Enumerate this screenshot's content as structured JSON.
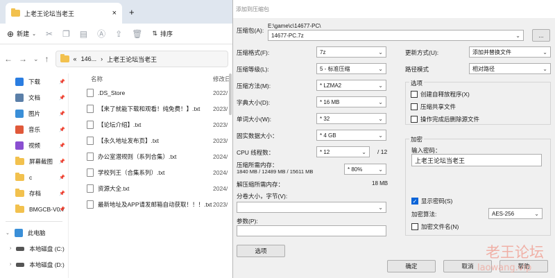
{
  "explorer": {
    "tab_title": "上老王论坛当老王",
    "tab_close": "×",
    "tab_add": "+",
    "new_label": "新建",
    "sort_label": "排序",
    "breadcrumb_root": "146...",
    "breadcrumb_current": "上老王论坛当老王",
    "sidebar": [
      {
        "label": "下载",
        "icon": "download-icon",
        "color": "#2a7de1"
      },
      {
        "label": "文档",
        "icon": "document-icon",
        "color": "#5b7fa8"
      },
      {
        "label": "图片",
        "icon": "picture-icon",
        "color": "#3a8fd8"
      },
      {
        "label": "音乐",
        "icon": "music-icon",
        "color": "#e0593a"
      },
      {
        "label": "视频",
        "icon": "video-icon",
        "color": "#8a4fd1"
      },
      {
        "label": "屏幕截图",
        "icon": "folder-icon",
        "color": "#f2c14e"
      },
      {
        "label": "c",
        "icon": "folder-icon",
        "color": "#f2c14e"
      },
      {
        "label": "存档",
        "icon": "folder-icon",
        "color": "#f2c14e"
      },
      {
        "label": "BMGCB-V0.7",
        "icon": "folder-icon",
        "color": "#f2c14e"
      }
    ],
    "this_pc": "此电脑",
    "drives": [
      "本地磁盘 (C:)",
      "本地磁盘 (D:)"
    ],
    "col_name": "名称",
    "col_date": "修改日",
    "files": [
      {
        "name": ".DS_Store",
        "date": "2022/"
      },
      {
        "name": "【来了就能下载和观看！纯免费！】.txt",
        "date": "2023/"
      },
      {
        "name": "【论坛介绍】.txt",
        "date": "2023/"
      },
      {
        "name": "【永久地址发布页】.txt",
        "date": "2023/"
      },
      {
        "name": "办公室潜规则（系列合集）.txt",
        "date": "2024/"
      },
      {
        "name": "学校列王（合集系列）.txt",
        "date": "2024/"
      },
      {
        "name": "资源大全.txt",
        "date": "2024/"
      },
      {
        "name": "最新地址及APP请发邮箱自动获取！！！.txt",
        "date": "2023/"
      }
    ]
  },
  "dialog": {
    "title": "添加到压缩包",
    "archive_label": "压缩包(A):",
    "archive_dir": "E:\\game\\c\\14677-PC\\",
    "archive_file": "14677-PC.7z",
    "browse": "...",
    "format_label": "压缩格式(F):",
    "format_value": "7z",
    "level_label": "压缩等级(L):",
    "level_value": "5 - 标准压缩",
    "method_label": "压缩方法(M):",
    "method_value": "* LZMA2",
    "dict_label": "字典大小(D):",
    "dict_value": "* 16 MB",
    "word_label": "单词大小(W):",
    "word_value": "* 32",
    "solid_label": "固实数据大小：",
    "solid_value": "* 4 GB",
    "threads_label": "CPU 线程数：",
    "threads_value": "* 12",
    "threads_total": "/ 12",
    "mem_label": "压缩所需内存：",
    "mem_detail": "1840 MB / 12489 MB / 15611 MB",
    "mem_value": "* 80%",
    "decomp_label": "解压缩所需内存：",
    "decomp_value": "18 MB",
    "split_label": "分卷大小，字节(V):",
    "params_label": "参数(P):",
    "options_btn": "选项",
    "update_label": "更新方式(U):",
    "update_value": "添加并替换文件",
    "path_label": "路径模式",
    "path_value": "相对路径",
    "options_group": "选项",
    "opt_sfx": "创建自释放程序(X)",
    "opt_shared": "压缩共享文件",
    "opt_delete": "操作完成后删除源文件",
    "enc_group": "加密",
    "pwd_label": "输入密码：",
    "pwd_value": "上老王论坛当老王",
    "show_pwd": "显示密码(S)",
    "enc_method_label": "加密算法:",
    "enc_method_value": "AES-256",
    "enc_names": "加密文件名(N)",
    "ok": "确定",
    "cancel": "取消",
    "help": "帮助"
  },
  "watermark": {
    "line1": "老王论坛",
    "line2": "laowang.vip"
  }
}
